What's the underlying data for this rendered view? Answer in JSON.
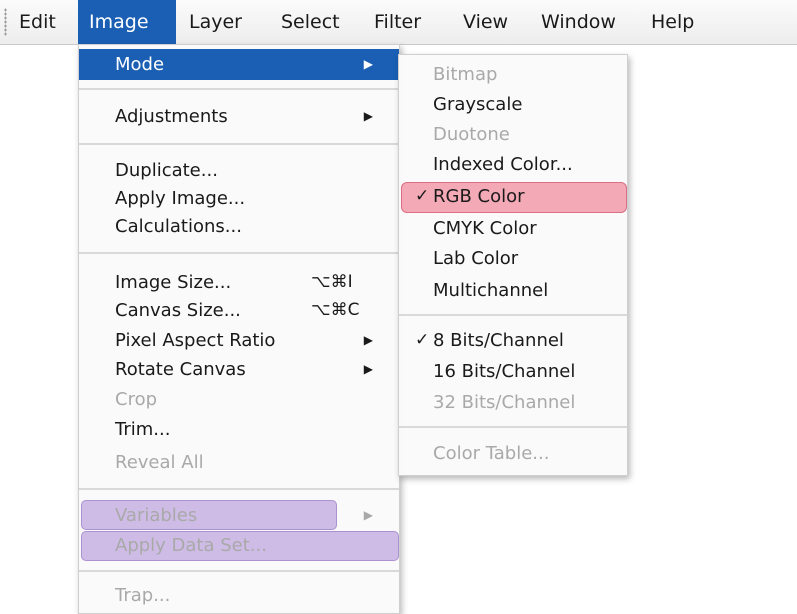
{
  "menubar": {
    "items": [
      "Edit",
      "Image",
      "Layer",
      "Select",
      "Filter",
      "View",
      "Window",
      "Help"
    ],
    "active": "Image"
  },
  "image_menu": {
    "items": [
      {
        "label": "Mode",
        "arrow": "▶",
        "highlighted": true
      },
      {
        "label": "Adjustments",
        "arrow": "▶"
      },
      {
        "label": "Duplicate..."
      },
      {
        "label": "Apply Image..."
      },
      {
        "label": "Calculations..."
      },
      {
        "label": "Image Size...",
        "shortcut": "⌥⌘I"
      },
      {
        "label": "Canvas Size...",
        "shortcut": "⌥⌘C"
      },
      {
        "label": "Pixel Aspect Ratio",
        "arrow": "▶"
      },
      {
        "label": "Rotate Canvas",
        "arrow": "▶"
      },
      {
        "label": "Crop",
        "disabled": true
      },
      {
        "label": "Trim..."
      },
      {
        "label": "Reveal All",
        "disabled": true
      },
      {
        "label": "Variables",
        "arrow": "▶",
        "disabled": true,
        "highlight_color": "purple"
      },
      {
        "label": "Apply Data Set...",
        "disabled": true,
        "highlight_color": "purple"
      },
      {
        "label": "Trap...",
        "disabled": true
      }
    ]
  },
  "mode_submenu": {
    "items": [
      {
        "label": "Bitmap",
        "disabled": true
      },
      {
        "label": "Grayscale"
      },
      {
        "label": "Duotone",
        "disabled": true
      },
      {
        "label": "Indexed Color..."
      },
      {
        "label": "RGB Color",
        "checked": true,
        "highlight_color": "pink"
      },
      {
        "label": "CMYK Color"
      },
      {
        "label": "Lab Color"
      },
      {
        "label": "Multichannel"
      },
      {
        "label": "8 Bits/Channel",
        "checked": true
      },
      {
        "label": "16 Bits/Channel"
      },
      {
        "label": "32 Bits/Channel",
        "disabled": true
      },
      {
        "label": "Color Table...",
        "disabled": true
      }
    ],
    "check_glyph": "✓"
  },
  "colors": {
    "selection_blue": "#1a5fb4",
    "annotation_purple": "#b396da",
    "annotation_pink": "#f0788c",
    "disabled_text": "#a9a9a9"
  }
}
